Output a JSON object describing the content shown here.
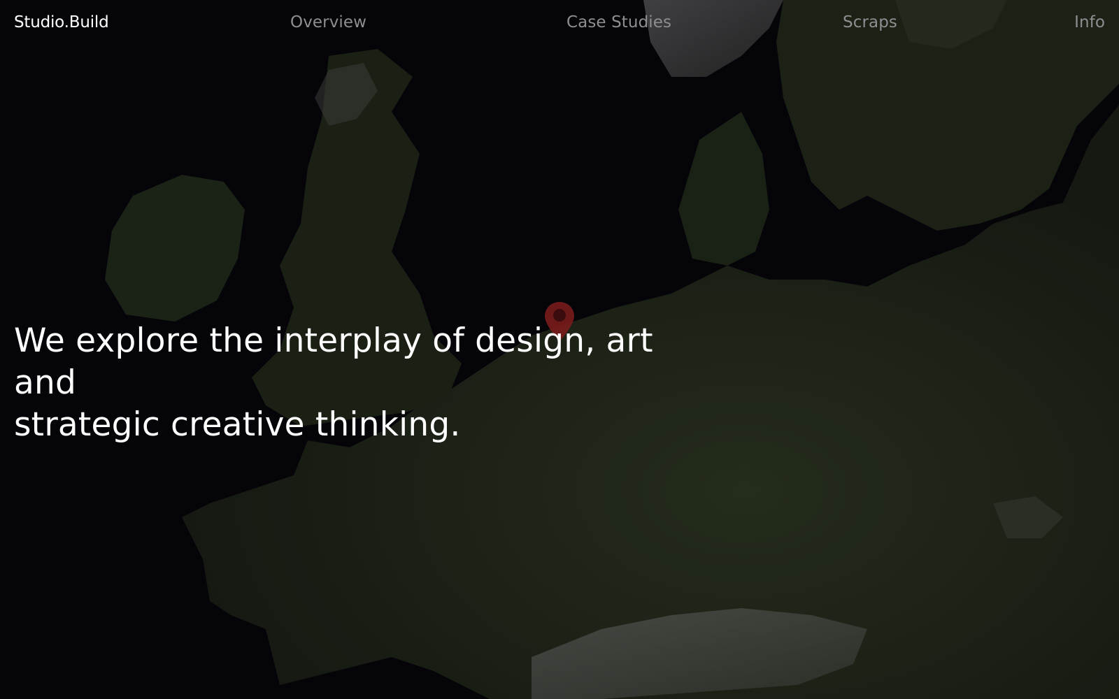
{
  "nav": {
    "brand": "Studio.Build",
    "items": [
      {
        "label": "Overview"
      },
      {
        "label": "Case Studies"
      },
      {
        "label": "Scraps"
      },
      {
        "label": "Info"
      }
    ]
  },
  "hero": {
    "line1": "We explore the interplay of design, art and",
    "line2": "strategic creative thinking."
  },
  "map": {
    "icon": "location-pin-icon",
    "pin_color": "#8a1f1f"
  },
  "colors": {
    "background": "#050409",
    "land": "#1c2316",
    "nav_text": "#8e8e92",
    "brand_text": "#ffffff"
  }
}
